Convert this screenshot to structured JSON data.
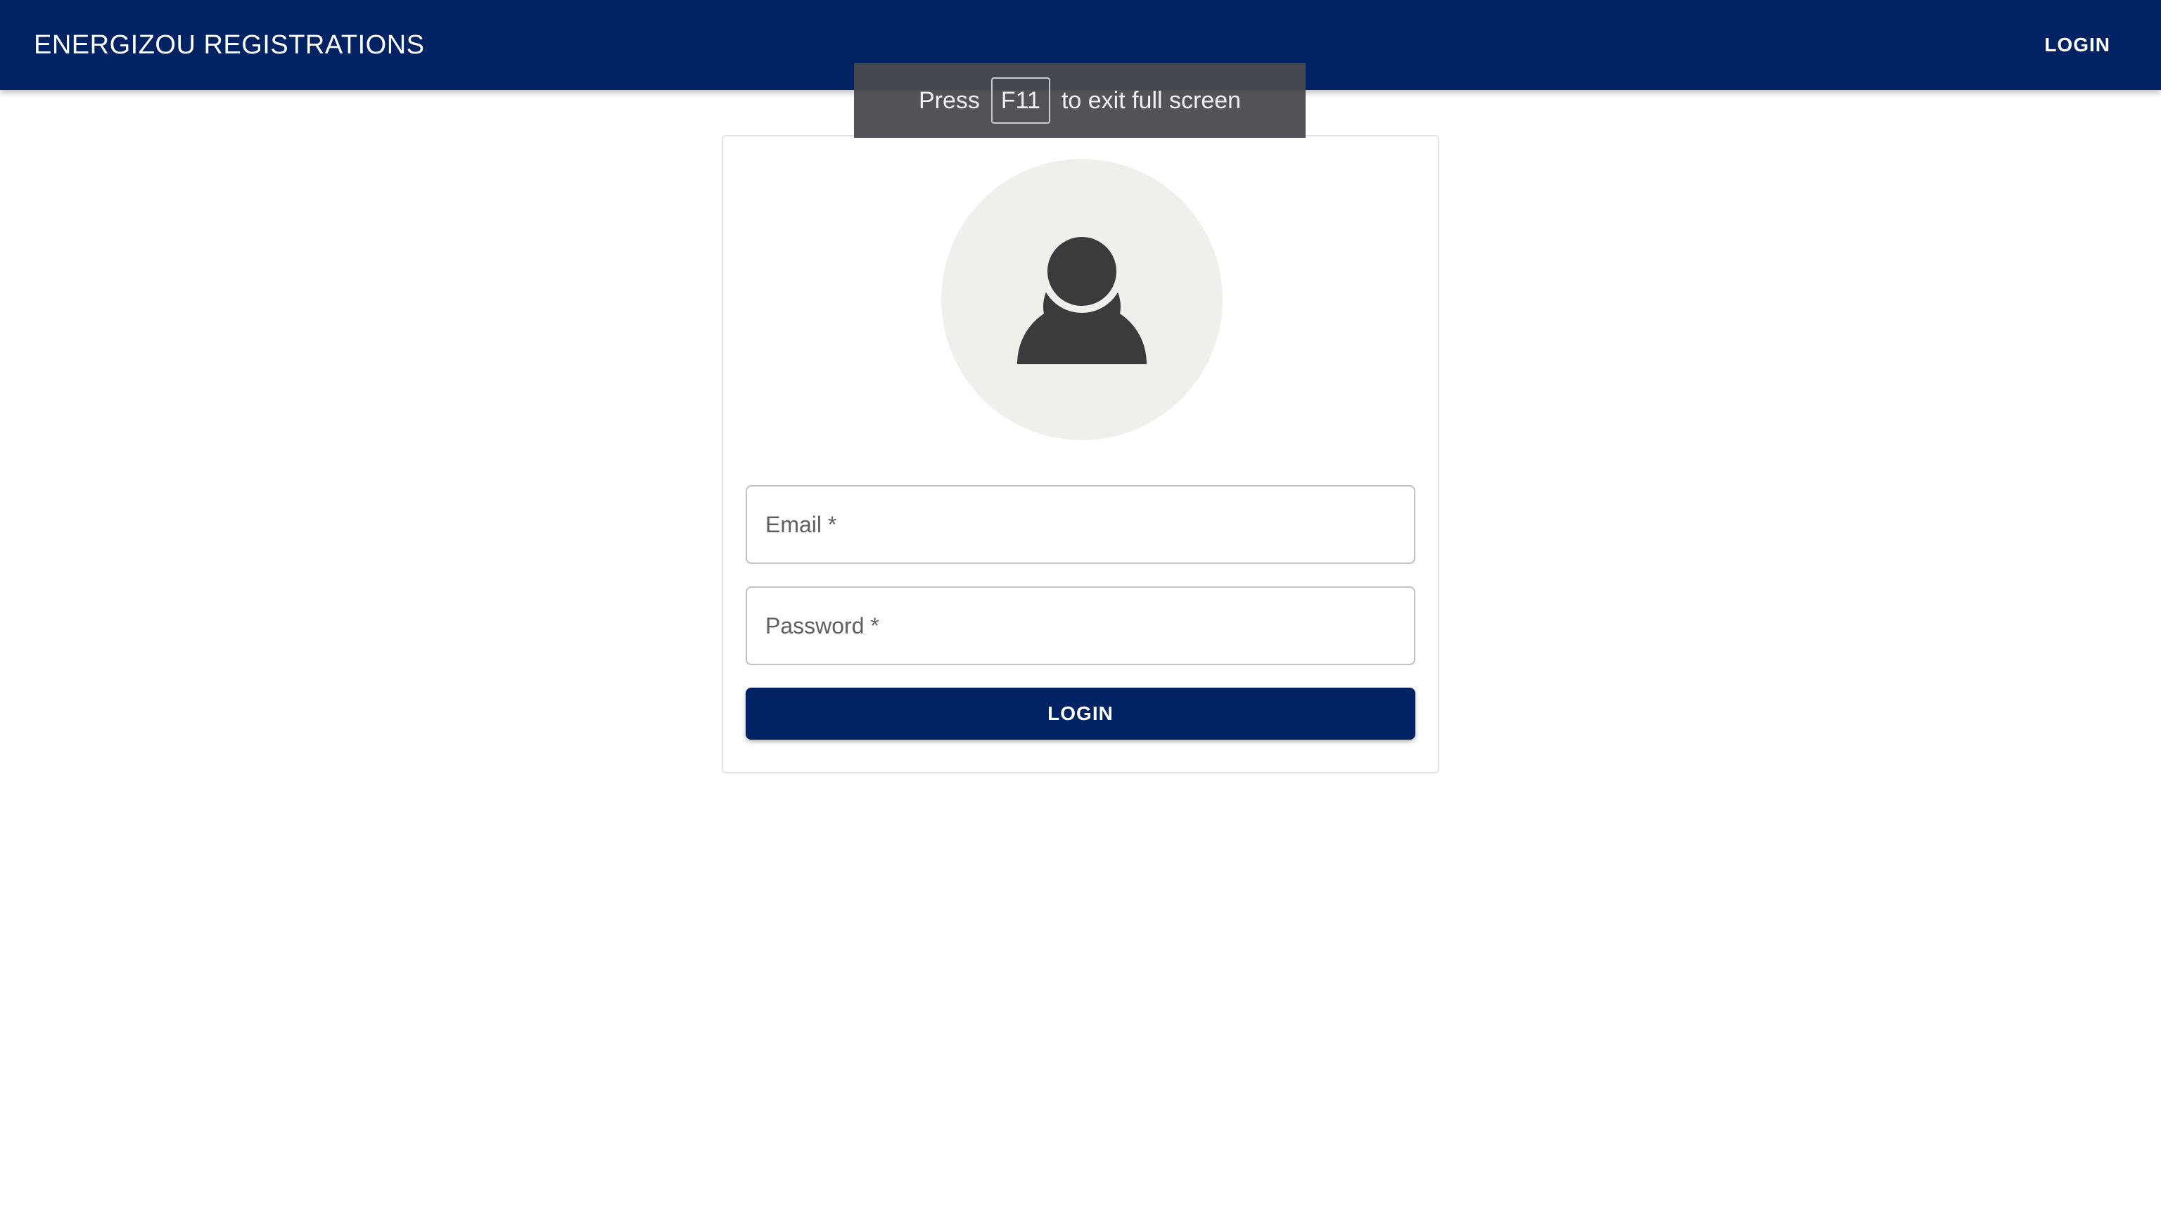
{
  "header": {
    "title": "ENERGIZOU REGISTRATIONS",
    "login_label": "LOGIN"
  },
  "fullscreen_notice": {
    "prefix": "Press",
    "key": "F11",
    "suffix": "to exit full screen"
  },
  "login_form": {
    "avatar_icon": "person-icon",
    "email_label": "Email *",
    "email_value": "",
    "password_label": "Password *",
    "password_value": "",
    "submit_label": "LOGIN"
  },
  "colors": {
    "primary": "#012363",
    "avatar_bg": "#efefec",
    "avatar_icon": "#3b3b3b"
  }
}
